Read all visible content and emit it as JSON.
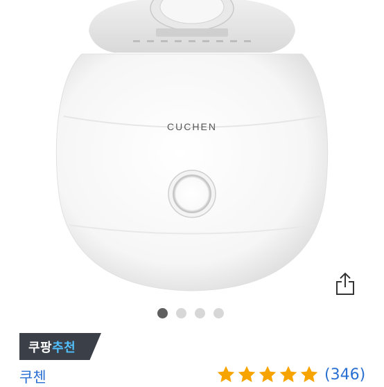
{
  "product": {
    "image_alt": "rice cooker product photo",
    "brand_logo": "CUCHEN",
    "share_icon": "share-icon"
  },
  "carousel": {
    "count": 4,
    "active_index": 0
  },
  "badge": {
    "prefix": "쿠팡",
    "highlight": "추천"
  },
  "seller": {
    "brand": "쿠첸"
  },
  "rating": {
    "stars": 5,
    "max": 5,
    "count_text": "(346)"
  },
  "colors": {
    "accent": "#2a6fd2",
    "star": "#f7a400",
    "badge_bg": "#3a3f48",
    "badge_highlight": "#52c1ff"
  }
}
